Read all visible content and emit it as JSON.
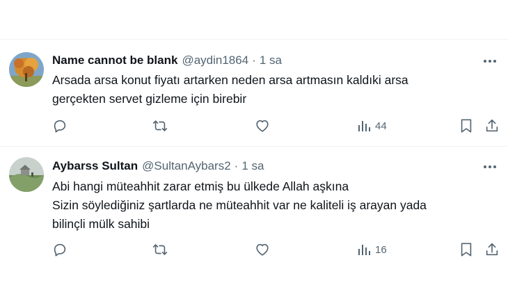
{
  "tweets": [
    {
      "author": {
        "name": "Name cannot be blank",
        "handle": "@aydin1864",
        "avatar": "autumn-tree-avatar"
      },
      "separator": "·",
      "time": "1 sa",
      "lines": [
        "Arsada arsa konut fiyatı artarken neden arsa artmasın kaldıki arsa",
        "gerçekten servet gizleme için birebir"
      ],
      "views": "44"
    },
    {
      "author": {
        "name": "Aybarss Sultan",
        "handle": "@SultanAybars2",
        "avatar": "landscape-avatar"
      },
      "separator": "·",
      "time": "1 sa",
      "lines": [
        "Abi hangi müteahhit zarar etmiş bu ülkede Allah aşkına",
        "Sizin söylediğiniz şartlarda ne müteahhit var ne kaliteli iş arayan yada",
        "bilinçli mülk sahibi"
      ],
      "views": "16"
    }
  ],
  "icons": {
    "reply": "reply-icon",
    "retweet": "retweet-icon",
    "like": "like-icon",
    "views": "views-icon",
    "bookmark": "bookmark-icon",
    "share": "share-icon",
    "more": "more-icon"
  },
  "colors": {
    "text": "#0f1419",
    "secondary": "#536471",
    "divider": "#eff3f4"
  }
}
